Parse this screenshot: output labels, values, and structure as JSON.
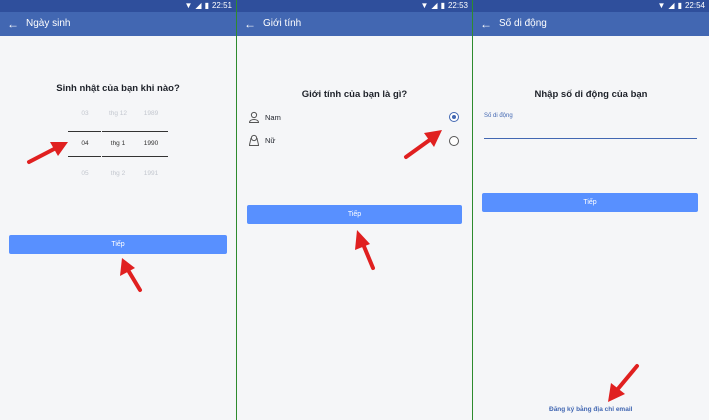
{
  "screens": [
    {
      "time": "22:51",
      "title": "Ngày sinh",
      "heading": "Sinh nhật của bạn khi nào?",
      "picker": {
        "day": [
          "03",
          "04",
          "05"
        ],
        "month": [
          "thg 12",
          "thg 1",
          "thg 2"
        ],
        "year": [
          "1989",
          "1990",
          "1991"
        ]
      },
      "button": "Tiếp"
    },
    {
      "time": "22:53",
      "title": "Giới tính",
      "heading": "Giới tính của bạn là gì?",
      "options": [
        {
          "label": "Nam",
          "selected": true
        },
        {
          "label": "Nữ",
          "selected": false
        }
      ],
      "button": "Tiếp"
    },
    {
      "time": "22:54",
      "title": "Số di động",
      "heading": "Nhập số di động của bạn",
      "field_label": "Số di động",
      "button": "Tiếp",
      "link": "Đăng ký bằng địa chỉ email"
    }
  ],
  "colors": {
    "appbar": "#4267b2",
    "statusbar": "#2f4f9c",
    "button": "#5890ff",
    "arrow": "#e02020",
    "panel_divider": "#2e8b2e"
  },
  "icons": [
    "back-arrow-icon",
    "wifi-icon",
    "signal-icon",
    "battery-icon",
    "male-person-icon",
    "female-person-icon",
    "annotation-arrow-icon"
  ]
}
